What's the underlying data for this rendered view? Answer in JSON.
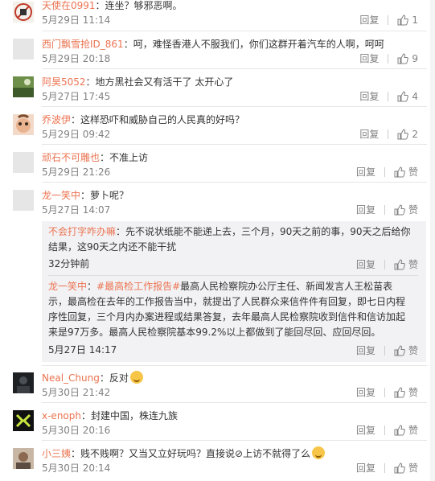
{
  "labels": {
    "reply": "回复",
    "like": "赞"
  },
  "colors": {
    "username": "#eb7350",
    "meta": "#808080",
    "quote_bg": "#f2f2f5"
  },
  "comments": [
    {
      "user": "天使在0991",
      "text": "：连坐？够邪恶啊。",
      "time": "5月29日 11:14",
      "likes": "1",
      "avatar": "no-entry-avatar"
    },
    {
      "user": "西门飘雪抢ID_861",
      "text": "：呵，难怪香港人不服我们，你们这群开着汽车的人啊，呵呵",
      "time": "5月29日 20:18",
      "likes": "9",
      "avatar": "default-avatar"
    },
    {
      "user": "阿昊5052",
      "text": "：地方黑社会又有活干了 太开心了",
      "time": "5月27日 17:45",
      "likes": "4",
      "avatar": "photo-avatar"
    },
    {
      "user": "乔波伊",
      "text": "：这样恐吓和威胁自己的人民真的好吗？",
      "time": "5月29日 09:42",
      "likes": "2",
      "avatar": "cartoon-avatar"
    },
    {
      "user": "顽石不可雕也",
      "text": "：不准上访",
      "time": "5月29日 21:26",
      "likes": "赞",
      "avatar": "default-avatar"
    },
    {
      "user": "龙一笑中",
      "text": "：萝卜呢？",
      "time": "5月27日 14:07",
      "likes": "赞",
      "avatar": "default-avatar"
    },
    {
      "user": "Neal_Chung",
      "text": "：反对",
      "time": "5月30日 21:42",
      "likes": "赞",
      "avatar": "dark-avatar"
    },
    {
      "user": "x-enoph",
      "text": "：封建中国，株连九族",
      "time": "5月30日 20:16",
      "likes": "赞",
      "avatar": "logo-avatar"
    },
    {
      "user": "小三姨",
      "text": "：贱不贱啊？又当又立好玩吗？直接说⊘上访不就得了么",
      "time": "5月30日 20:14",
      "likes": "赞",
      "avatar": "photo-avatar"
    }
  ],
  "replies": [
    {
      "user": "不会打字咋办嘛",
      "text": "：先不说状纸能不能递上去，三个月，90天之前的事，90天之后给你结果，这90天之内还不能干扰",
      "time": "32分钟前",
      "likes": "赞"
    },
    {
      "user": "龙一笑中",
      "text_prefix": "：",
      "topic": "#最高检工作报告#",
      "text": "最高人民检察院办公厅主任、新闻发言人王松苗表示，最高检在去年的工作报告当中，就提出了人民群众来信件件有回复，即七日内程序性回复，三个月内办案进程或结果答复，去年最高人民检察院收到信件和信访加起来是97万多。最高人民检察院基本99.2%以上都做到了能回尽回、应回尽回。",
      "time": "5月27日 14:17",
      "likes": "赞"
    }
  ]
}
